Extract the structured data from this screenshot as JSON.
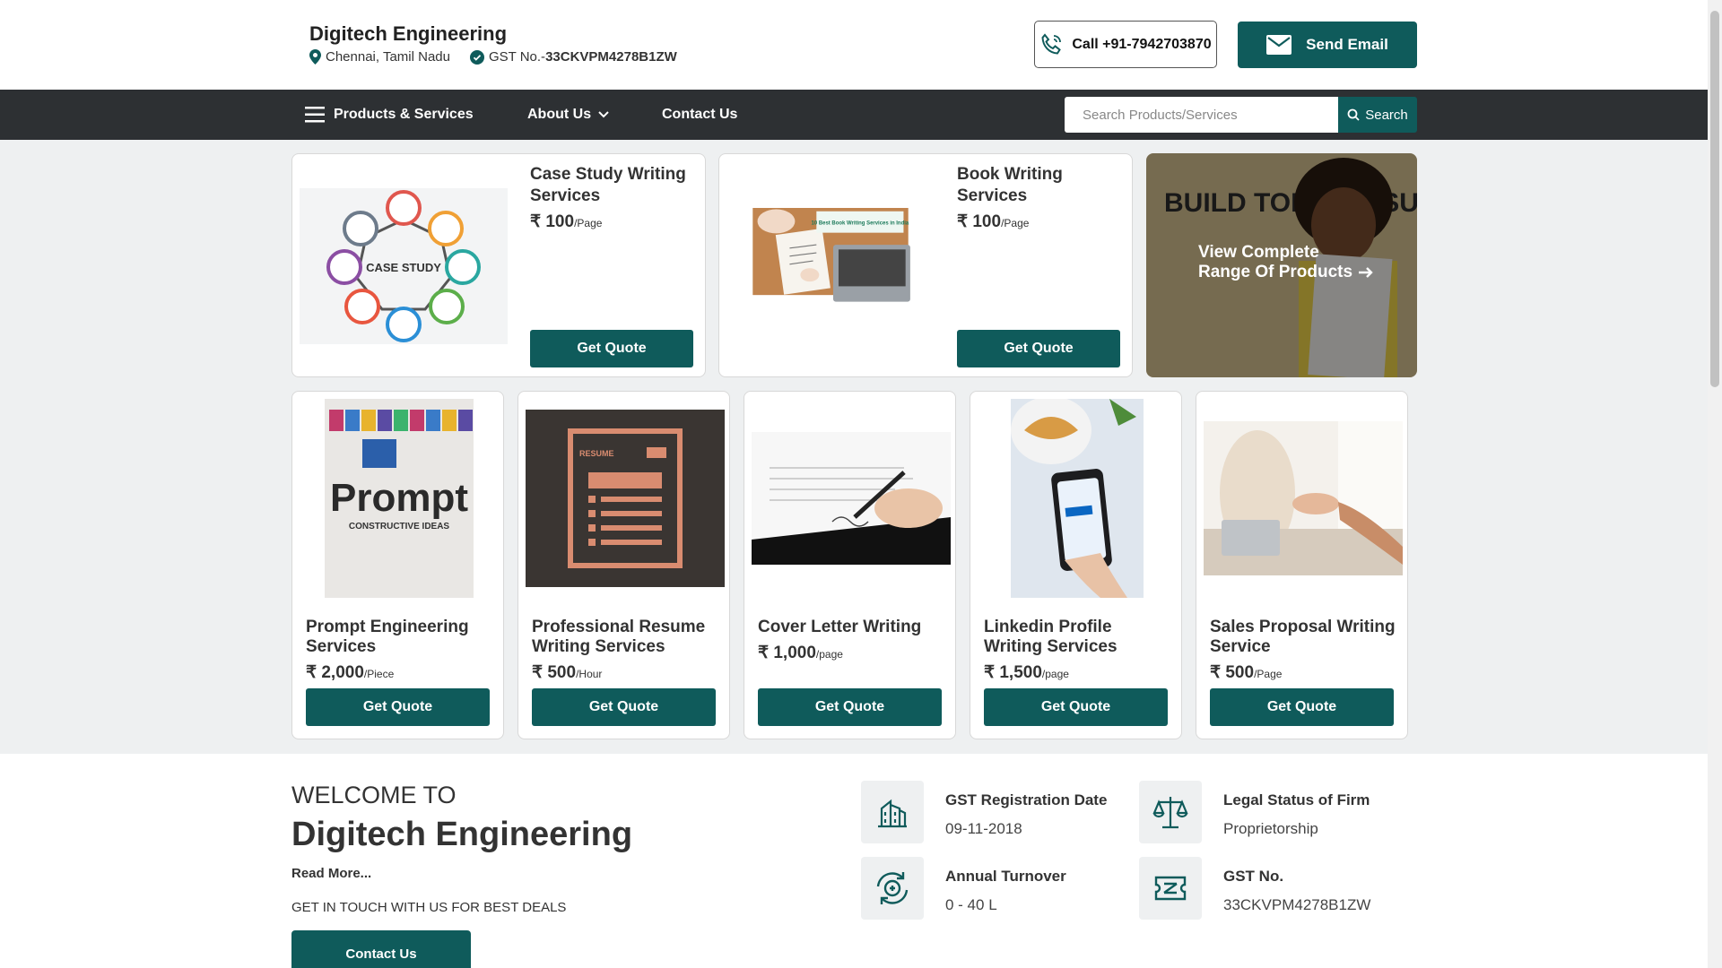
{
  "header": {
    "company_name": "Digitech Engineering",
    "location": "Chennai, Tamil Nadu",
    "gst_prefix": "GST No.-",
    "gst_number": "33CKVPM4278B1ZW",
    "call_label": "Call +91-7942703870",
    "email_label": "Send Email"
  },
  "nav": {
    "products": "Products & Services",
    "about": "About Us",
    "contact": "Contact Us",
    "search_placeholder": "Search Products/Services",
    "search_label": "Search"
  },
  "featured": [
    {
      "title": "Case Study Writing Services",
      "price": "₹ 100",
      "unit": "/Page",
      "button": "Get Quote"
    },
    {
      "title": "Book Writing Services",
      "price": "₹ 100",
      "unit": "/Page",
      "button": "Get Quote"
    }
  ],
  "view_all": {
    "line1": "View Complete",
    "line2": "Range Of Products"
  },
  "products": [
    {
      "title": "Prompt Engineering Services",
      "price": "₹ 2,000",
      "unit": "/Piece",
      "button": "Get Quote"
    },
    {
      "title": "Professional Resume Writing Services",
      "price": "₹ 500",
      "unit": "/Hour",
      "button": "Get Quote"
    },
    {
      "title": "Cover Letter Writing",
      "price": "₹ 1,000",
      "unit": "/page",
      "button": "Get Quote"
    },
    {
      "title": "Linkedin Profile Writing Services",
      "price": "₹ 1,500",
      "unit": "/page",
      "button": "Get Quote"
    },
    {
      "title": "Sales Proposal Writing Service",
      "price": "₹ 500",
      "unit": "/Page",
      "button": "Get Quote"
    }
  ],
  "image_text": {
    "case_study": "CASE STUDY",
    "book_banner": "10 Best Book Writing Services in India",
    "prompt_line1": "Prompt",
    "prompt_line2": "CONSTRUCTIVE IDEAS",
    "resume_doc": "RESUME",
    "build_top": "BUILD TOP Q RESUME"
  },
  "welcome": {
    "sub": "WELCOME TO",
    "title": "Digitech Engineering",
    "read_more": "Read More...",
    "touch": "GET IN TOUCH WITH US FOR BEST DEALS",
    "contact_button": "Contact Us"
  },
  "facts": [
    {
      "label": "GST Registration Date",
      "value": "09-11-2018",
      "icon": "building-icon"
    },
    {
      "label": "Legal Status of Firm",
      "value": "Proprietorship",
      "icon": "scales-icon"
    },
    {
      "label": "Annual Turnover",
      "value": "0 - 40 L",
      "icon": "turnover-icon"
    },
    {
      "label": "GST No.",
      "value": "33CKVPM4278B1ZW",
      "icon": "ticket-icon"
    }
  ],
  "colors": {
    "primary": "#0f5b5b",
    "nav_bg": "#2d3033",
    "section_bg": "#eef0f1"
  }
}
